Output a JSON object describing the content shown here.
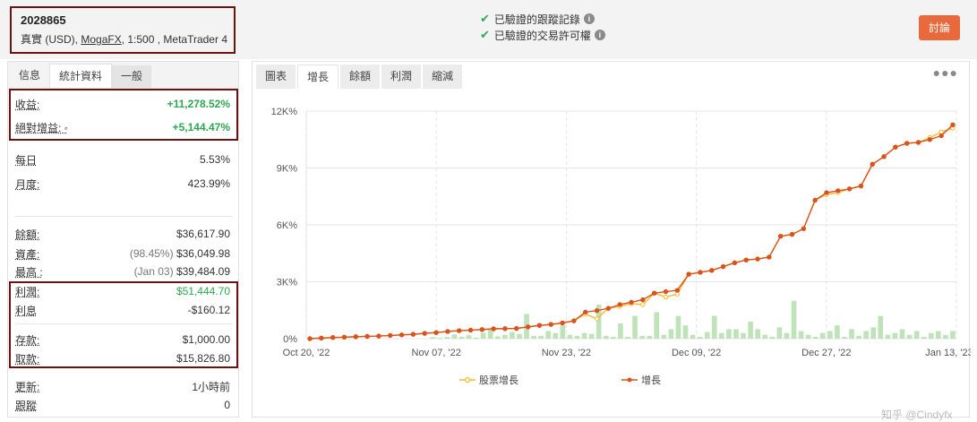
{
  "header": {
    "account_id": "2028865",
    "account_type": "真實 (USD),",
    "broker": "MogaFX",
    "leverage_platform": ", 1:500 , MetaTrader 4",
    "verified": [
      {
        "text": "已驗證的跟蹤記錄"
      },
      {
        "text": "已驗證的交易許可權"
      }
    ],
    "discuss_button": "討論"
  },
  "left_tabs": [
    "信息",
    "統計資料",
    "一般"
  ],
  "stats": {
    "gain": {
      "label": "收益:",
      "value": "+11,278.52%"
    },
    "abs_gain": {
      "label": "絕對增益: ◦",
      "value": "+5,144.47%"
    },
    "daily": {
      "label": "每日",
      "value": "5.53%"
    },
    "monthly": {
      "label": "月度:",
      "value": "423.99%"
    },
    "balance": {
      "label": "餘額:",
      "value": "$36,617.90"
    },
    "equity": {
      "label": "資產:",
      "note": "(98.45%)",
      "value": "$36,049.98"
    },
    "highest": {
      "label": "最高 :",
      "note": "(Jan 03)",
      "value": "$39,484.09"
    },
    "profit": {
      "label": "利潤:",
      "value": "$51,444.70"
    },
    "interest": {
      "label": "利息",
      "value": "-$160.12"
    },
    "deposits": {
      "label": "存款:",
      "value": "$1,000.00"
    },
    "withdrawals": {
      "label": "取款:",
      "value": "$15,826.80"
    },
    "updated": {
      "label": "更新:",
      "value": "1小時前"
    },
    "tracking": {
      "label": "跟蹤",
      "value": "0"
    }
  },
  "chart_tabs": [
    "圖表",
    "增長",
    "餘額",
    "利潤",
    "縮減"
  ],
  "more_icon": "more-dots-icon",
  "legend": {
    "equity_growth": "股票增長",
    "growth": "增長"
  },
  "watermark": "知乎 @Cindyfx",
  "colors": {
    "growth": "#d9531e",
    "equity_growth": "#f5b932",
    "bars": "#bfe3b8",
    "accent": "#e8693c",
    "highlight_box": "#6b1212",
    "green_text": "#2fa84f"
  },
  "chart_data": {
    "type": "line",
    "title": "",
    "x_tick_labels": [
      "Oct 20, '22",
      "Nov 07, '22",
      "Nov 23, '22",
      "Dec 09, '22",
      "Dec 27, '22",
      "Jan 13, '23"
    ],
    "y_tick_labels": [
      "0%",
      "3K%",
      "6K%",
      "9K%",
      "12K%"
    ],
    "ylim": [
      0,
      12000
    ],
    "legend_position": "bottom",
    "series": [
      {
        "name": "增長",
        "values": [
          0,
          30,
          60,
          80,
          100,
          120,
          140,
          170,
          200,
          230,
          280,
          320,
          380,
          420,
          450,
          480,
          520,
          530,
          540,
          620,
          700,
          750,
          830,
          940,
          1400,
          1480,
          1600,
          1800,
          1920,
          2050,
          2400,
          2480,
          2550,
          3400,
          3500,
          3600,
          3800,
          4000,
          4150,
          4200,
          4300,
          5400,
          5500,
          5800,
          7300,
          7700,
          7800,
          7900,
          8050,
          9200,
          9600,
          10100,
          10300,
          10350,
          10500,
          10700,
          11278
        ]
      },
      {
        "name": "股票增長",
        "values": [
          0,
          30,
          60,
          80,
          100,
          120,
          140,
          170,
          200,
          230,
          280,
          320,
          380,
          420,
          450,
          480,
          520,
          530,
          540,
          620,
          700,
          750,
          830,
          940,
          1300,
          1050,
          1600,
          1700,
          1850,
          1800,
          2400,
          2200,
          2350,
          3400,
          3500,
          3600,
          3800,
          4000,
          4150,
          4200,
          4300,
          5400,
          5500,
          5800,
          7300,
          7600,
          7700,
          7900,
          8050,
          9200,
          9600,
          10100,
          10300,
          10350,
          10600,
          10900,
          11100
        ]
      }
    ],
    "bars": [
      0,
      0,
      0,
      0,
      0,
      0,
      0,
      0,
      0,
      0,
      0,
      0,
      0,
      0,
      0,
      0,
      0,
      80,
      40,
      90,
      220,
      100,
      180,
      60,
      300,
      500,
      120,
      200,
      350,
      250,
      1300,
      150,
      150,
      400,
      300,
      700,
      200,
      150,
      300,
      250,
      1800,
      150,
      100,
      800,
      100,
      1200,
      150,
      150,
      1400,
      200,
      500,
      1200,
      700,
      200,
      100,
      350,
      1200,
      300,
      500,
      500,
      300,
      900,
      500,
      200,
      100,
      600,
      300,
      2000,
      400,
      200,
      100,
      300,
      400,
      700,
      100,
      500,
      150,
      400,
      600,
      1200,
      200,
      300,
      500,
      200,
      400,
      100,
      300,
      400,
      200,
      400
    ]
  }
}
